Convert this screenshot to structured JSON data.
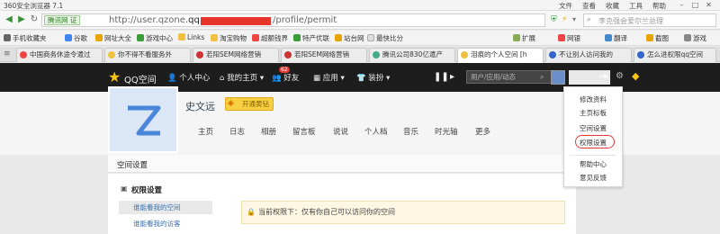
{
  "window": {
    "title": "360安全浏览器 7.1",
    "menu": [
      "文件",
      "查看",
      "收藏",
      "工具",
      "帮助"
    ]
  },
  "address": {
    "badge": "腾讯网 证",
    "url_prefix": "http://user.qzone.",
    "url_domain": "qq.com",
    "url_suffix": "/profile/permit",
    "search_placeholder": "李克强会爱尔兰总理"
  },
  "bookmarks": {
    "items": [
      "手机收藏夹",
      "谷歌",
      "网址大全",
      "游戏中心",
      "Links",
      "淘宝购物",
      "超额钱界",
      "特产优联",
      "站台网",
      "最快比分"
    ],
    "right": [
      "扩展",
      "网银",
      "翻译",
      "截图",
      "游戏"
    ]
  },
  "tabs": [
    {
      "label": "中国商务休途令遣过"
    },
    {
      "label": "你不得不看服务外"
    },
    {
      "label": "若阳SEM网络营销"
    },
    {
      "label": "若阳SEM网络营销"
    },
    {
      "label": "腾讯公司830亿遣产"
    },
    {
      "label": "泪痕的个人空间 [h"
    },
    {
      "label": "不让别人访问我的"
    },
    {
      "label": "怎么进权限qq空间"
    }
  ],
  "qq_nav": {
    "logo": "QQ空间",
    "items": [
      "个人中心",
      "我的主页",
      "好友",
      "应用",
      "装扮"
    ],
    "friend_badge": "62",
    "search_placeholder": "用户/应用/动态"
  },
  "profile": {
    "name": "史文远",
    "vip_label": "开通黄钻",
    "nav": [
      "主页",
      "日志",
      "相册",
      "留言板",
      "说说",
      "个人档",
      "音乐",
      "时光轴",
      "更多"
    ]
  },
  "settings": {
    "header": "空间设置",
    "side_title": "权限设置",
    "side_items": [
      "谁能看我的空间",
      "谁能看我的访客"
    ],
    "notice": "当前权限下：仅有你自己可以访问你的空间"
  },
  "dropdown": {
    "items": [
      "修改资料",
      "主页标板",
      "空间设置",
      "权限设置"
    ],
    "items2": [
      "帮助中心",
      "意见反馈"
    ]
  },
  "colors": {
    "accent_red": "#e53935",
    "qq_bar": "#1d1d1d",
    "vip_gold": "#f7cf42"
  }
}
